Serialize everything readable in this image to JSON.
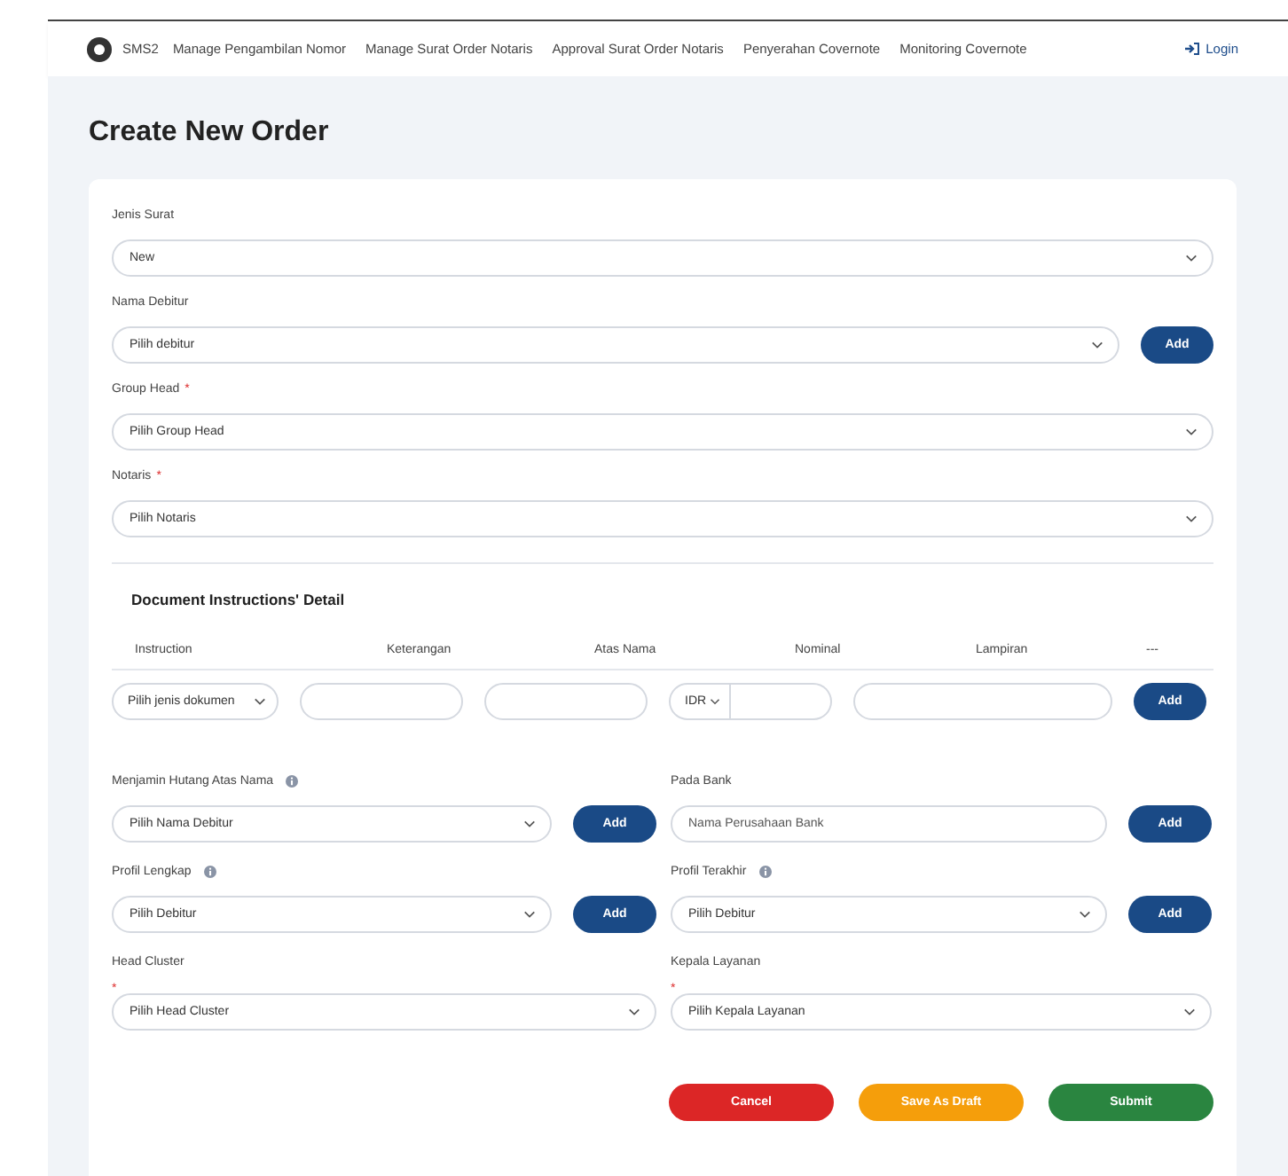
{
  "navbar": {
    "brand": "SMS2",
    "items": [
      "Manage Pengambilan Nomor",
      "Manage Surat Order Notaris",
      "Approval Surat Order Notaris",
      "Penyerahan Covernote",
      "Monitoring Covernote"
    ],
    "login": "Login"
  },
  "page_title": "Create New Order",
  "fields": [
    {
      "kind": "select",
      "label": "Jenis Surat",
      "value": "New"
    },
    {
      "kind": "select_add",
      "label": "Nama Debitur",
      "value": "Pilih debitur",
      "button": "Add"
    },
    {
      "kind": "select",
      "label": "Group Head",
      "required_mark": "*",
      "value": "Pilih Group Head"
    },
    {
      "kind": "select",
      "label": "Notaris",
      "required_mark": "*",
      "value": "Pilih Notaris"
    }
  ],
  "instructions": {
    "title": "Document Instructions' Detail",
    "columns": [
      "Instruction",
      "Keterangan",
      "Atas Nama",
      "Nominal",
      "Lampiran",
      "---"
    ],
    "instruction_select": "Pilih jenis dokumen",
    "currency": "IDR",
    "button": "Add"
  },
  "extra_fields": [
    {
      "kind": "select_add",
      "label": "Menjamin Hutang Atas Nama",
      "info": true,
      "value": "Pilih Nama Debitur",
      "button": "Add"
    },
    {
      "kind": "input_add",
      "label": "Pada Bank",
      "info": false,
      "placeholder": "Nama Perusahaan Bank",
      "button": "Add"
    },
    {
      "kind": "select_add",
      "label": "Profil Lengkap",
      "info": true,
      "value": "Pilih Debitur",
      "button": "Add"
    },
    {
      "kind": "select_add",
      "label": "Profil Terakhir",
      "info": true,
      "value": "Pilih Debitur",
      "button": "Add"
    },
    {
      "kind": "select",
      "label": "Head Cluster",
      "info": false,
      "required_mark": "*",
      "value": "Pilih Head Cluster"
    },
    {
      "kind": "select",
      "label": "Kepala Layanan",
      "info": false,
      "required_mark": "*",
      "value": "Pilih Kepala Layanan"
    }
  ],
  "actions": [
    {
      "kind": "cancel",
      "label": "Cancel"
    },
    {
      "kind": "draft",
      "label": "Save As Draft"
    },
    {
      "kind": "submit",
      "label": "Submit"
    }
  ]
}
